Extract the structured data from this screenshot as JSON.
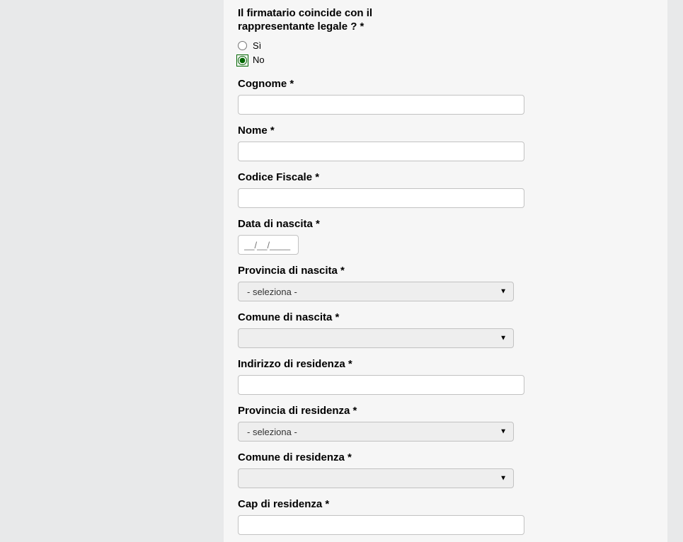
{
  "question": {
    "label": "Il firmatario coincide con il rappresentante legale ? *",
    "options": {
      "yes": "Sì",
      "no": "No"
    },
    "selected": "no"
  },
  "fields": {
    "cognome": {
      "label": "Cognome *",
      "value": ""
    },
    "nome": {
      "label": "Nome *",
      "value": ""
    },
    "codice_fiscale": {
      "label": "Codice Fiscale *",
      "value": ""
    },
    "data_nascita": {
      "label": "Data di nascita *",
      "placeholder": "__/__/____",
      "value": ""
    },
    "provincia_nascita": {
      "label": "Provincia di nascita *",
      "selected": "- seleziona -"
    },
    "comune_nascita": {
      "label": "Comune di nascita *",
      "selected": ""
    },
    "indirizzo_residenza": {
      "label": "Indirizzo di residenza *",
      "value": ""
    },
    "provincia_residenza": {
      "label": "Provincia di residenza *",
      "selected": "- seleziona -"
    },
    "comune_residenza": {
      "label": "Comune di residenza *",
      "selected": ""
    },
    "cap_residenza": {
      "label": "Cap di residenza *",
      "value": ""
    }
  }
}
